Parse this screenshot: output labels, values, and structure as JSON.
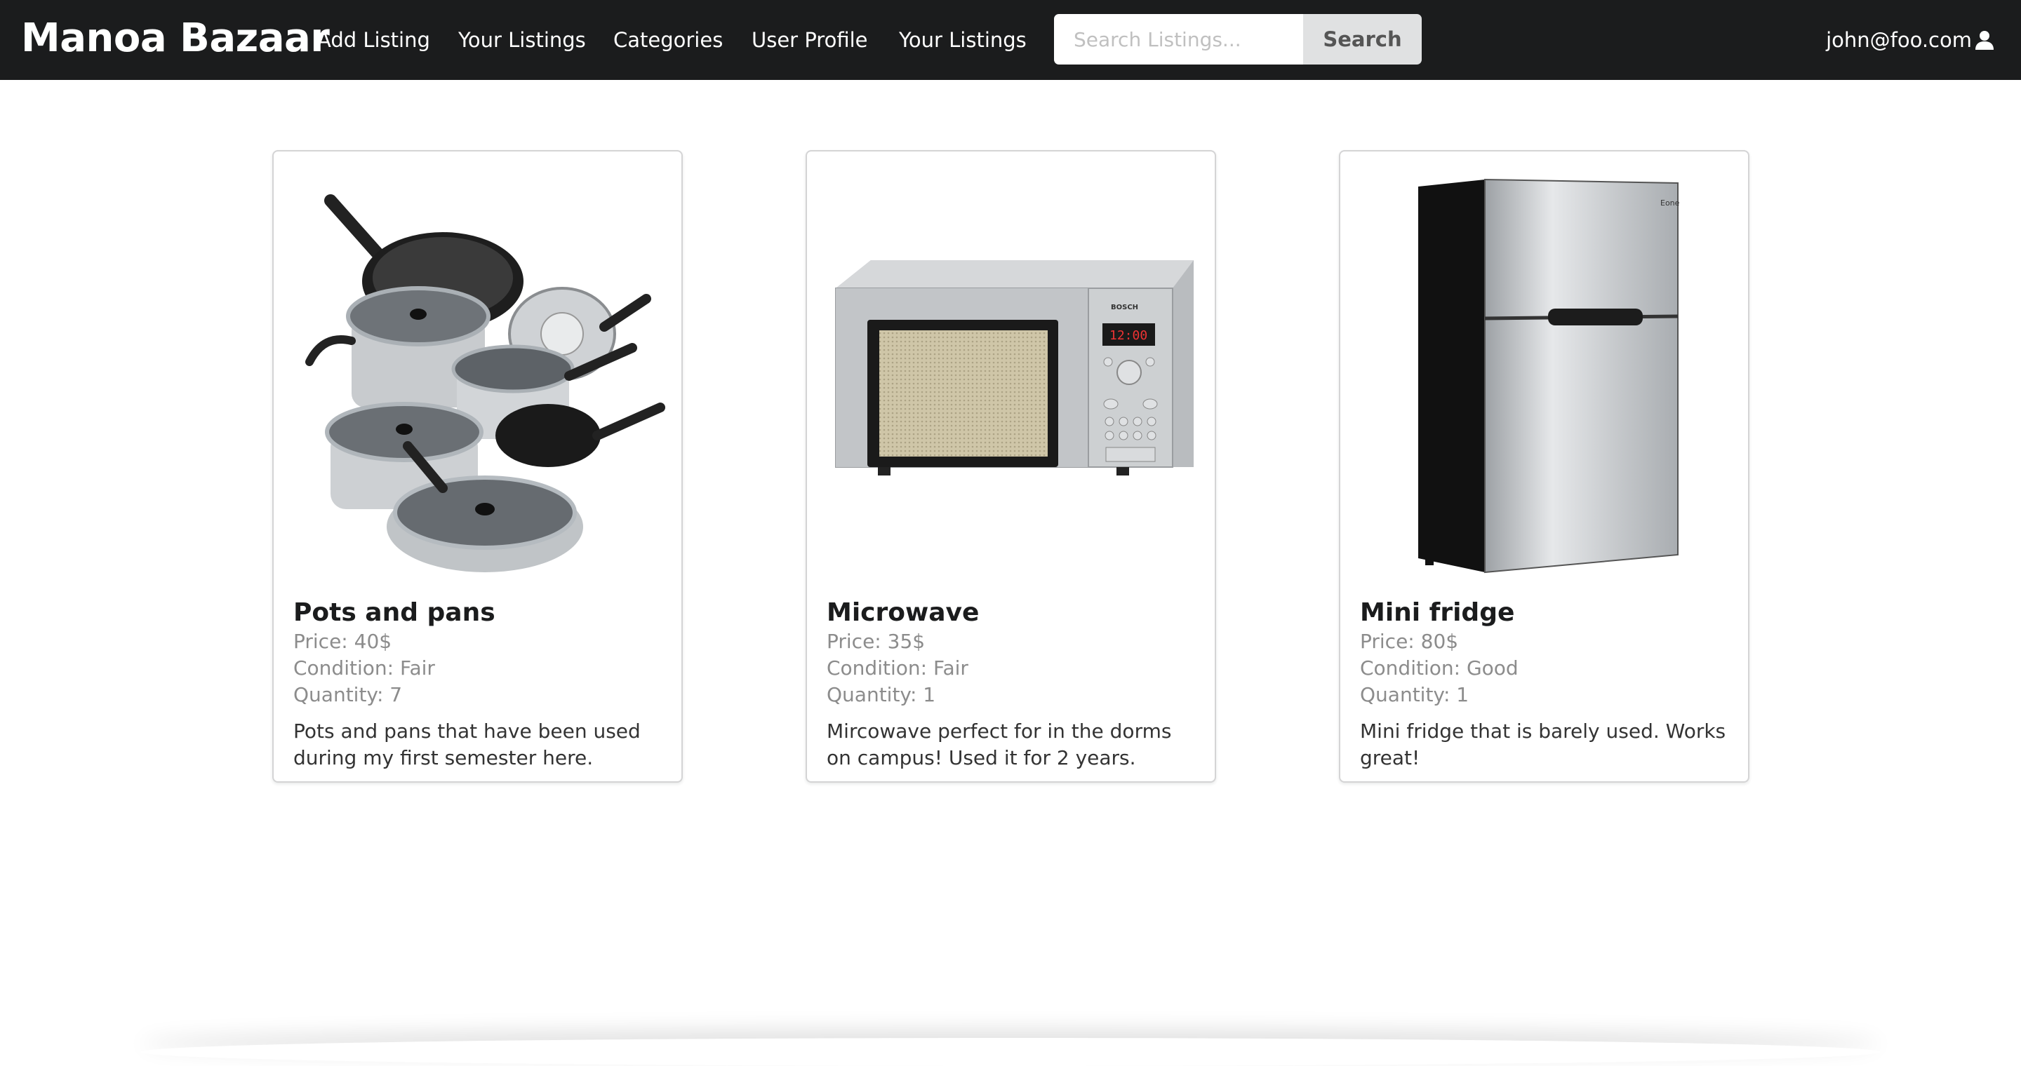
{
  "navbar": {
    "brand": "Manoa Bazaar",
    "items": [
      {
        "label": "Add Listing"
      },
      {
        "label": "Your Listings"
      },
      {
        "label": "Categories"
      },
      {
        "label": "User Profile"
      },
      {
        "label": "Your Listings"
      }
    ],
    "search": {
      "placeholder": "Search Listings...",
      "button_label": "Search"
    },
    "user": {
      "email": "john@foo.com",
      "icon": "user-icon"
    }
  },
  "listings": [
    {
      "title": "Pots and pans",
      "price": "Price: 40$",
      "condition": "Condition: Fair",
      "quantity": "Quantity: 7",
      "description": "Pots and pans that have been used during my first semester here.",
      "image_icon": "cookware-image"
    },
    {
      "title": "Microwave",
      "price": "Price: 35$",
      "condition": "Condition: Fair",
      "quantity": "Quantity: 1",
      "description": "Mircowave perfect for in the dorms on campus! Used it for 2 years.",
      "image_icon": "microwave-image",
      "brand_text": "BOSCH",
      "display_text": "12:00"
    },
    {
      "title": "Mini fridge",
      "price": "Price: 80$",
      "condition": "Condition: Good",
      "quantity": "Quantity: 1",
      "description": "Mini fridge that is barely used. Works great!",
      "image_icon": "fridge-image",
      "brand_text": "Eone"
    }
  ],
  "colors": {
    "navbar": "#1b1c1d",
    "card_border": "#d4d4d5",
    "meta_text": "#8c8c8c"
  }
}
